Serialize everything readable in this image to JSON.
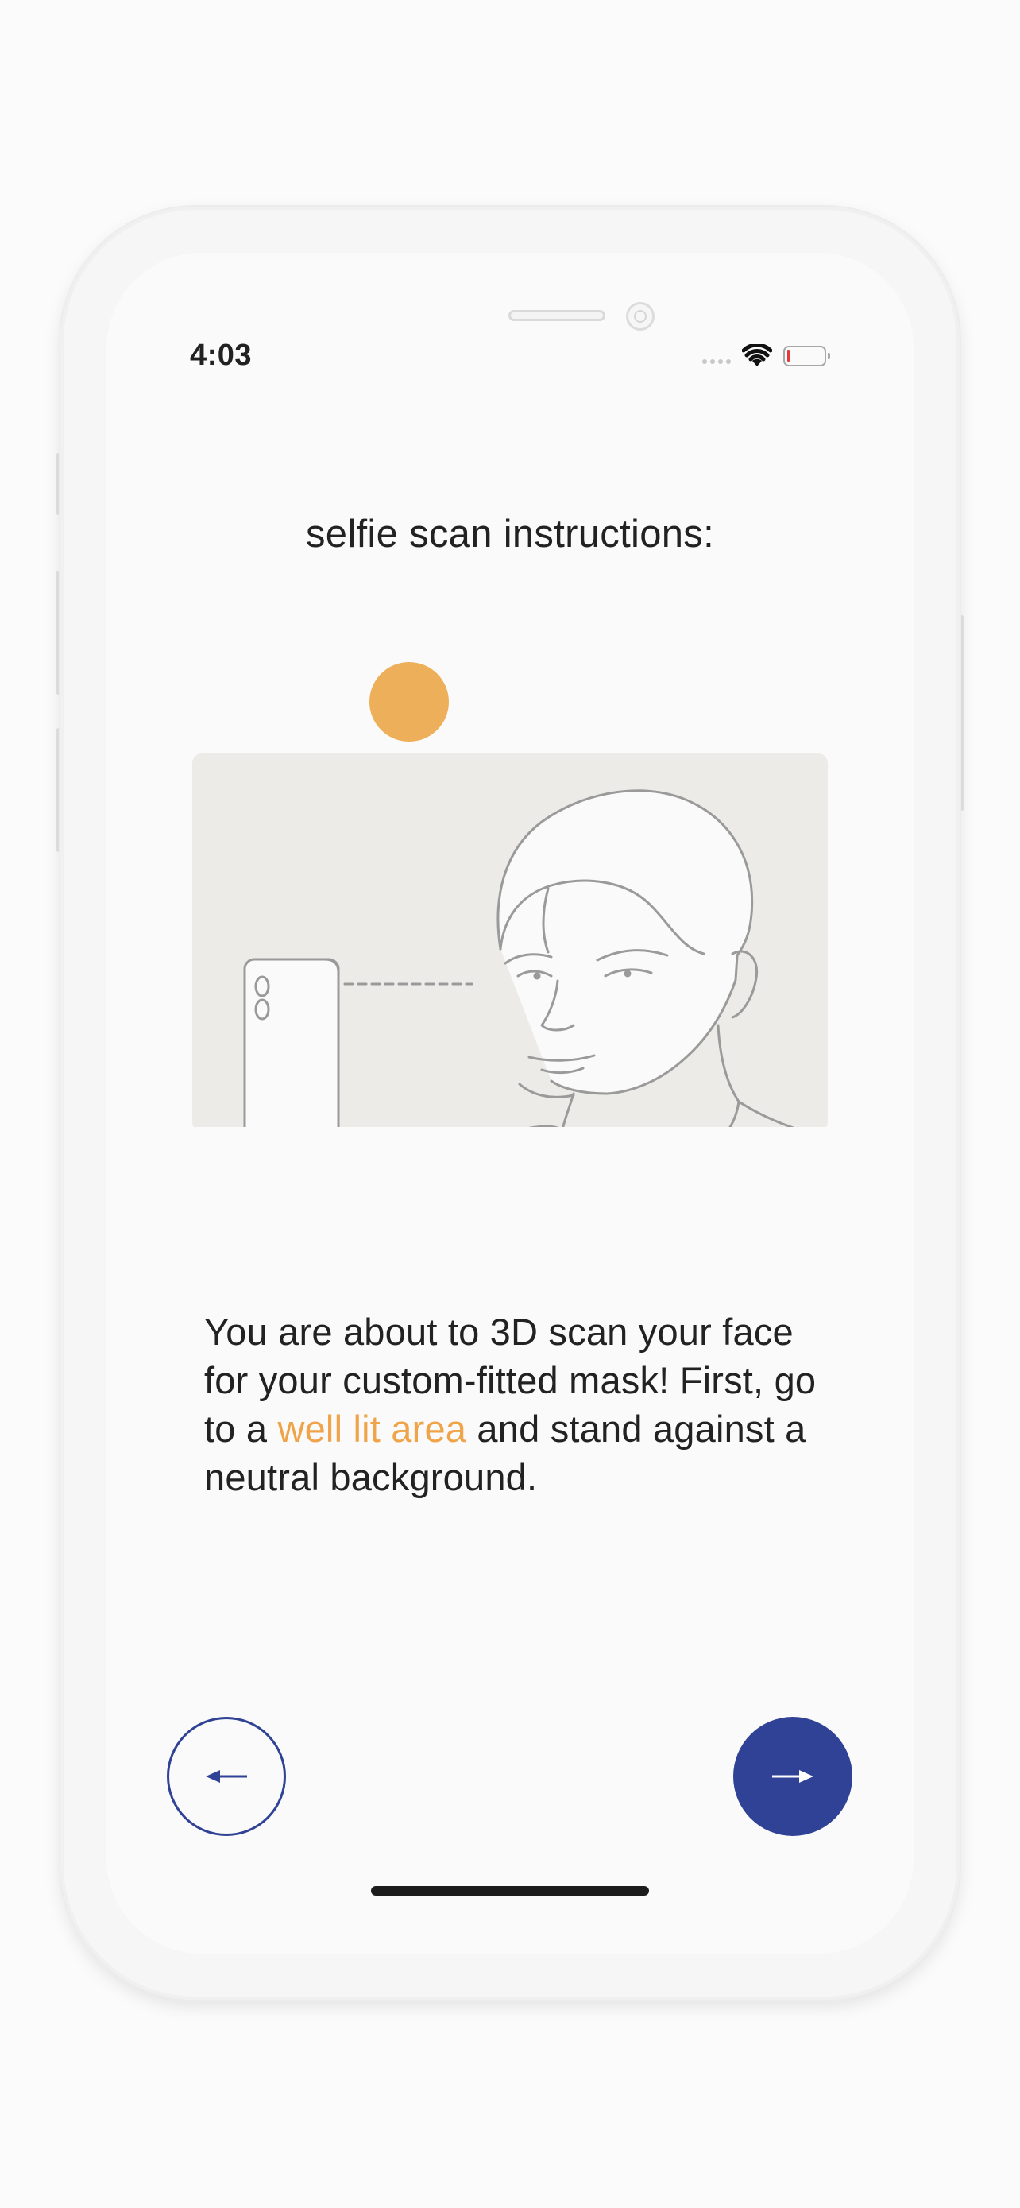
{
  "status_bar": {
    "time": "4:03",
    "signal_icon": "cellular-dots-icon",
    "wifi_icon": "wifi-icon",
    "battery_icon": "battery-low-icon",
    "battery_level": 0.05
  },
  "screen": {
    "title": "selfie scan instructions:"
  },
  "illustration": {
    "subject": "phone-facing-person-illustration",
    "light_color": "#EEAF5A",
    "backdrop_color": "#ECEBE7",
    "line_color": "#9A9A9A"
  },
  "instructions": {
    "text_before": "You are about to 3D scan your face for your custom-fitted mask! First, go to a ",
    "highlight": "well lit area",
    "text_after": " and stand against a neutral background."
  },
  "navigation": {
    "back_icon": "arrow-left-icon",
    "next_icon": "arrow-right-icon"
  },
  "colors": {
    "primary": "#2F4295",
    "accent": "#F0A449",
    "text": "#222222",
    "background": "#FAFAFA"
  }
}
